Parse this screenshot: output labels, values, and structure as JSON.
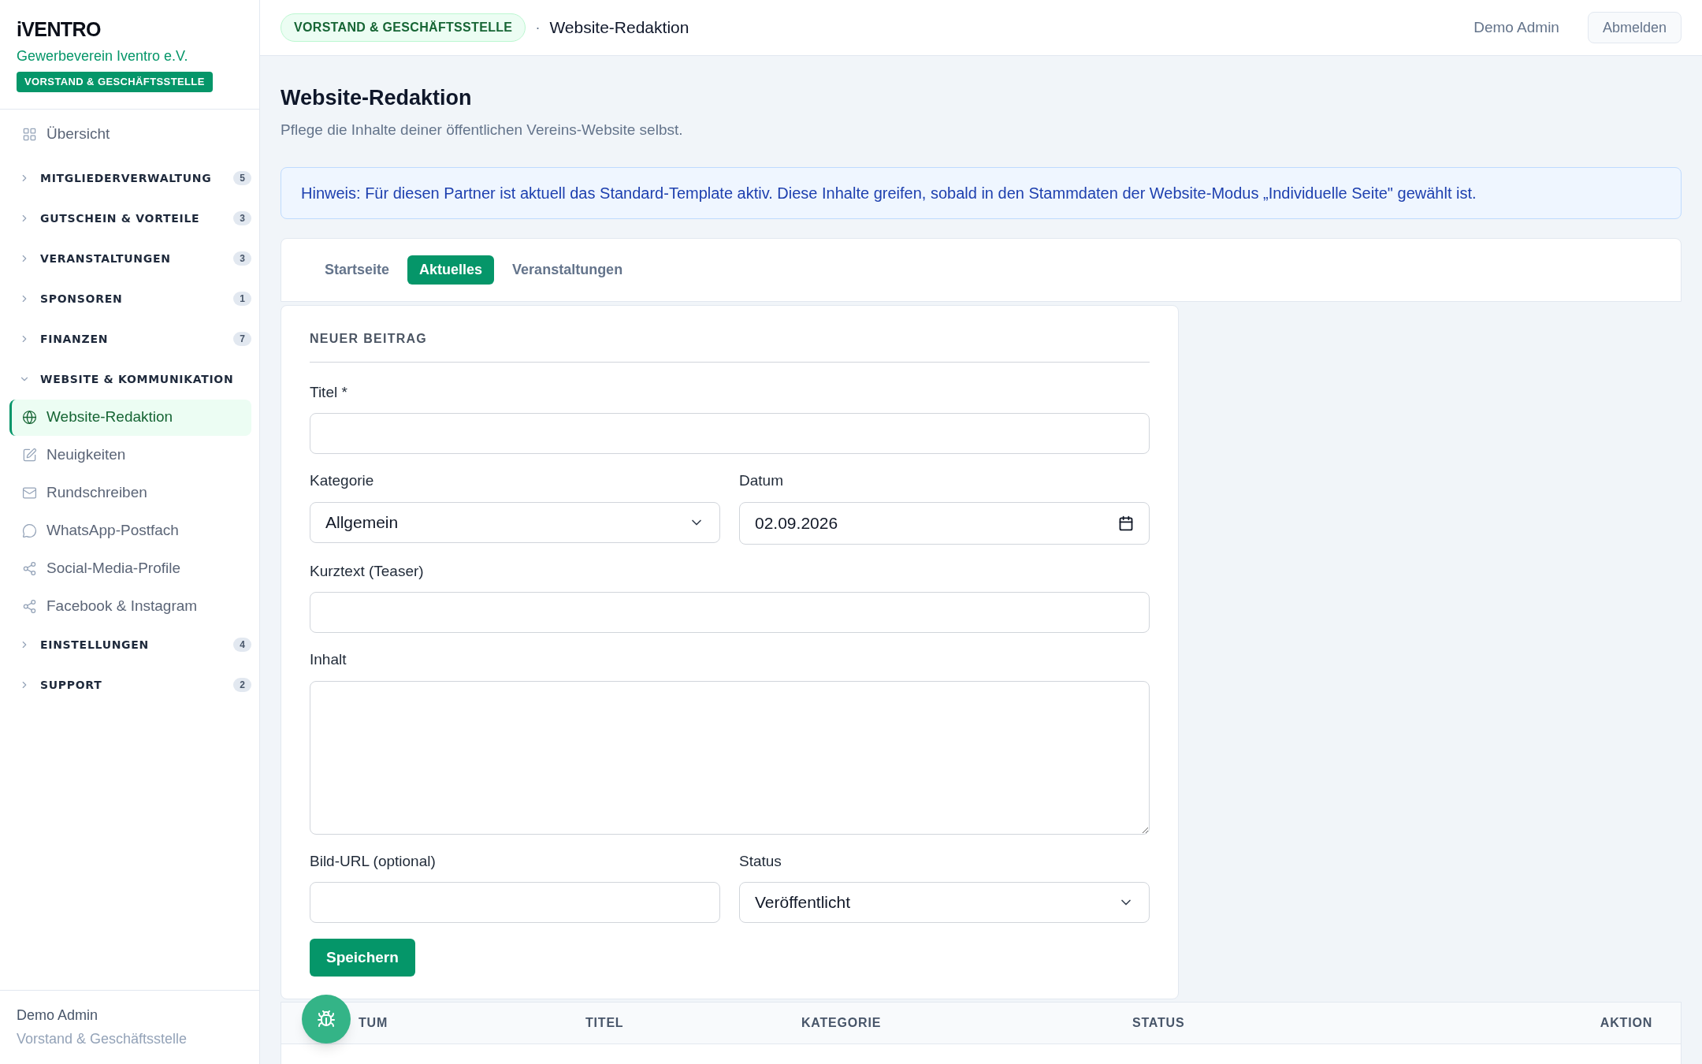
{
  "sidebar": {
    "logo": "iVENTRO",
    "organization": "Gewerbeverein Iventro e.V.",
    "role_badge": "VORSTAND & GESCHÄFTSSTELLE",
    "nav": [
      {
        "kind": "link",
        "label": "Übersicht",
        "selected": false
      },
      {
        "kind": "group",
        "label": "MITGLIEDERVERWALTUNG",
        "count": "5",
        "expanded": false
      },
      {
        "kind": "group",
        "label": "GUTSCHEIN & VORTEILE",
        "count": "3",
        "expanded": false
      },
      {
        "kind": "group",
        "label": "VERANSTALTUNGEN",
        "count": "3",
        "expanded": false
      },
      {
        "kind": "group",
        "label": "SPONSOREN",
        "count": "1",
        "expanded": false
      },
      {
        "kind": "group",
        "label": "FINANZEN",
        "count": "7",
        "expanded": false
      },
      {
        "kind": "group",
        "label": "WEBSITE & KOMMUNIKATION",
        "expanded": true,
        "children": [
          {
            "label": "Website-Redaktion",
            "selected": true
          },
          {
            "label": "Neuigkeiten",
            "selected": false
          },
          {
            "label": "Rundschreiben",
            "selected": false
          },
          {
            "label": "WhatsApp-Postfach",
            "selected": false
          },
          {
            "label": "Social-Media-Profile",
            "selected": false
          },
          {
            "label": "Facebook & Instagram",
            "selected": false
          }
        ]
      },
      {
        "kind": "group",
        "label": "EINSTELLUNGEN",
        "count": "4",
        "expanded": false
      },
      {
        "kind": "group",
        "label": "SUPPORT",
        "count": "2",
        "expanded": false
      }
    ],
    "footer": {
      "name": "Demo Admin",
      "role": "Vorstand & Geschäftsstelle"
    }
  },
  "header": {
    "badge": "VORSTAND & GESCHÄFTSSTELLE",
    "separator": "·",
    "page": "Website-Redaktion",
    "user": "Demo Admin",
    "logout": "Abmelden"
  },
  "page": {
    "title": "Website-Redaktion",
    "subtitle": "Pflege die Inhalte deiner öffentlichen Vereins-Website selbst.",
    "notice": "Hinweis: Für diesen Partner ist aktuell das Standard-Template aktiv. Diese Inhalte greifen, sobald in den Stammdaten der Website-Modus „Individuelle Seite\" gewählt ist.",
    "tabs": [
      {
        "label": "Startseite",
        "selected": false
      },
      {
        "label": "Aktuelles",
        "selected": true
      },
      {
        "label": "Veranstaltungen",
        "selected": false
      }
    ],
    "form": {
      "heading": "NEUER BEITRAG",
      "rows": [
        {
          "fields": [
            {
              "kind": "text",
              "label": "Titel *"
            }
          ]
        },
        {
          "fields": [
            {
              "kind": "select",
              "label": "Kategorie",
              "value": "Allgemein"
            },
            {
              "kind": "date",
              "label": "Datum",
              "value": "02.09.2026"
            }
          ]
        },
        {
          "fields": [
            {
              "kind": "text",
              "label": "Kurztext (Teaser)"
            }
          ]
        },
        {
          "fields": [
            {
              "kind": "textarea",
              "label": "Inhalt"
            }
          ]
        },
        {
          "fields": [
            {
              "kind": "text",
              "label": "Bild-URL (optional)"
            },
            {
              "kind": "select",
              "label": "Status",
              "value": "Veröffentlicht"
            }
          ]
        }
      ],
      "submit": "Speichern"
    },
    "table": {
      "columns": [
        "TUM",
        "TITEL",
        "KATEGORIE",
        "STATUS",
        "AKTION"
      ]
    }
  }
}
